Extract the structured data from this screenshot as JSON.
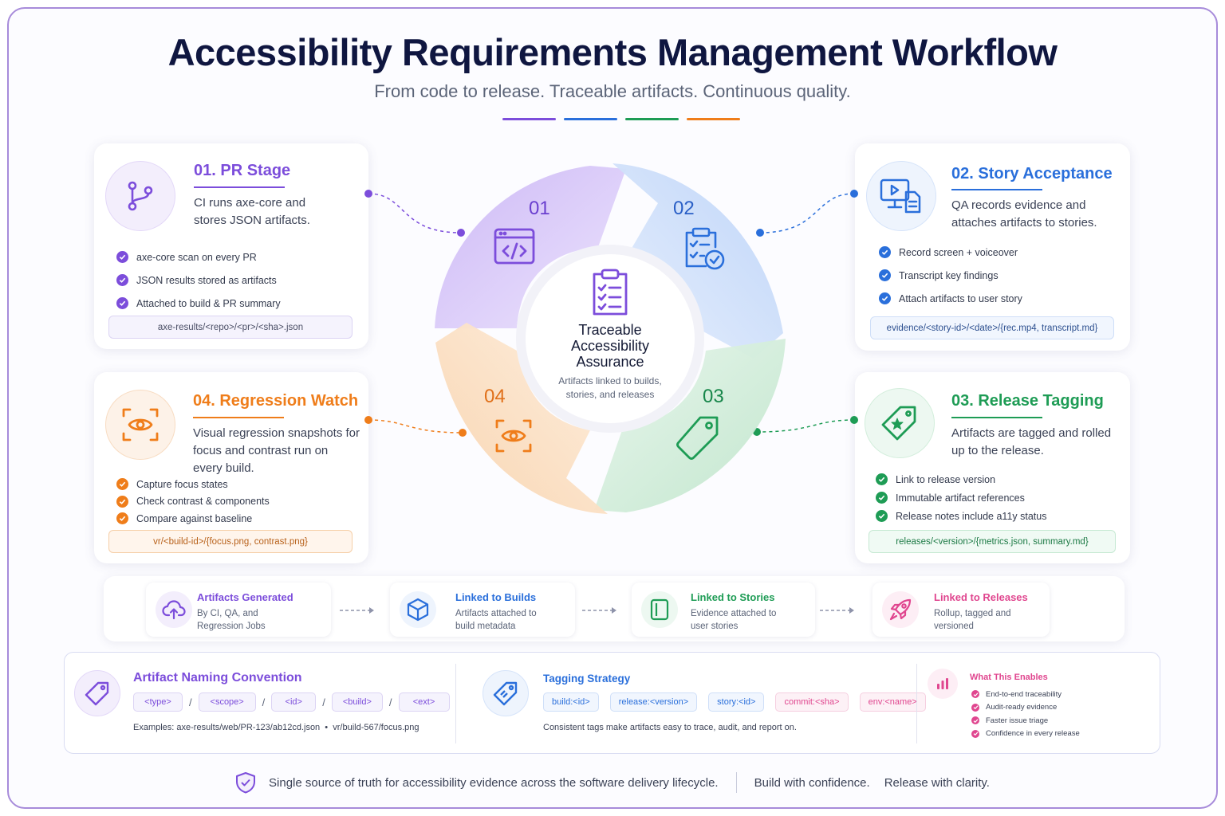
{
  "title": "Accessibility Requirements Management Workflow",
  "subtitle": "From code to release. Traceable artifacts. Continuous quality.",
  "colors": {
    "purple": "#7c4ddb",
    "blue": "#2a6fdb",
    "green": "#1e9c55",
    "orange": "#ef7d1a",
    "pink": "#e0468f"
  },
  "center": {
    "title_lines": [
      "Traceable",
      "Accessibility",
      "Assurance"
    ],
    "desc_lines": [
      "Artifacts linked to builds,",
      "stories, and releases"
    ]
  },
  "segments": [
    {
      "num": "01",
      "icon": "code-window-icon"
    },
    {
      "num": "02",
      "icon": "clipboard-check-icon"
    },
    {
      "num": "03",
      "icon": "tag-icon"
    },
    {
      "num": "04",
      "icon": "eye-scan-icon"
    }
  ],
  "stages": {
    "pr": {
      "title": "01. PR Stage",
      "desc_lines": [
        "CI runs axe-core and",
        "stores JSON artifacts."
      ],
      "checks": [
        "axe-core scan on every PR",
        "JSON results stored as artifacts",
        "Attached to build & PR summary"
      ],
      "path": "axe-results/<repo>/<pr>/<sha>.json",
      "icon": "git-branch-icon"
    },
    "story": {
      "title": "02. Story Acceptance",
      "desc_lines": [
        "QA records evidence and",
        "attaches artifacts to stories."
      ],
      "checks": [
        "Record screen + voiceover",
        "Transcript key findings",
        "Attach artifacts to user story"
      ],
      "path": "evidence/<story-id>/<date>/{rec.mp4, transcript.md}",
      "icon": "monitor-document-icon"
    },
    "release": {
      "title": "03. Release Tagging",
      "desc_lines": [
        "Artifacts are tagged and rolled",
        "up to the release."
      ],
      "checks": [
        "Link to release version",
        "Immutable artifact references",
        "Release notes include a11y status"
      ],
      "path": "releases/<version>/{metrics.json, summary.md}",
      "icon": "star-tag-icon"
    },
    "regression": {
      "title": "04. Regression Watch",
      "desc_lines": [
        "Visual regression snapshots for",
        "focus and contrast run on",
        "every build."
      ],
      "checks": [
        "Capture focus states",
        "Check contrast & components",
        "Compare against baseline"
      ],
      "path": "vr/<build-id>/{focus.png, contrast.png}",
      "icon": "eye-scan-icon"
    }
  },
  "flow": [
    {
      "title": "Artifacts Generated",
      "desc_lines": [
        "By CI, QA, and",
        "Regression Jobs"
      ],
      "icon": "cloud-upload-icon"
    },
    {
      "title": "Linked to Builds",
      "desc_lines": [
        "Artifacts attached to",
        "build metadata"
      ],
      "icon": "cube-icon"
    },
    {
      "title": "Linked to Stories",
      "desc_lines": [
        "Evidence attached to",
        "user stories"
      ],
      "icon": "document-icon"
    },
    {
      "title": "Linked to Releases",
      "desc_lines": [
        "Rollup, tagged and",
        "versioned"
      ],
      "icon": "rocket-icon"
    }
  ],
  "naming": {
    "title": "Artifact Naming Convention",
    "parts": [
      "<type>",
      "<scope>",
      "<id>",
      "<build>",
      "<ext>"
    ],
    "separator": "/",
    "examples": "Examples: axe-results/web/PR-123/ab12cd.json  •  vr/build-567/focus.png"
  },
  "tagging": {
    "title": "Tagging Strategy",
    "tags": [
      "build:<id>",
      "release:<version>",
      "story:<id>",
      "commit:<sha>",
      "env:<name>"
    ],
    "note": "Consistent tags make artifacts easy to trace, audit, and report on."
  },
  "enables": {
    "title": "What This Enables",
    "items": [
      "End-to-end traceability",
      "Audit-ready evidence",
      "Faster issue triage",
      "Confidence in every release"
    ]
  },
  "footer": {
    "main": "Single source of truth for accessibility evidence across the software delivery lifecycle.",
    "build": "Build with confidence.",
    "release": "Release with clarity."
  }
}
